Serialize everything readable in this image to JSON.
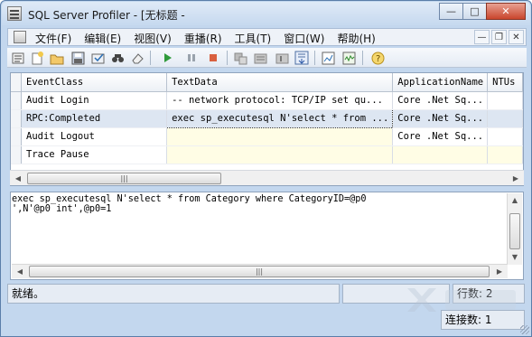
{
  "window": {
    "title": "SQL Server Profiler - [无标题 -"
  },
  "menu": [
    "文件(F)",
    "编辑(E)",
    "视图(V)",
    "重播(R)",
    "工具(T)",
    "窗口(W)",
    "帮助(H)"
  ],
  "grid": {
    "columns": [
      "EventClass",
      "TextData",
      "ApplicationName",
      "NTUs"
    ],
    "rows": [
      {
        "event": "Audit Login",
        "text": "-- network protocol: TCP/IP  set qu...",
        "app": "Core .Net Sq..."
      },
      {
        "event": "RPC:Completed",
        "text": "exec sp_executesql N'select * from ...",
        "app": "Core .Net Sq..."
      },
      {
        "event": "Audit Logout",
        "text": "",
        "app": "Core .Net Sq..."
      },
      {
        "event": "Trace Pause",
        "text": "",
        "app": ""
      }
    ]
  },
  "detail": {
    "line1": "exec sp_executesql N'select * from Category where CategoryID=@p0",
    "line2": "',N'@p0 int',@p0=1"
  },
  "status": {
    "ready": "就绪。",
    "rows": "行数: 2",
    "connections": "连接数: 1"
  },
  "icons": {
    "toolbar": [
      "new-trace-icon",
      "new-template-icon",
      "open-icon",
      "save-icon",
      "properties-icon",
      "find-icon",
      "clear-icon",
      "run-icon",
      "pause-icon",
      "stop-icon",
      "replay-icons",
      "auto-scroll-icon",
      "help-icon"
    ]
  },
  "colors": {
    "titlebar": "#c6d9ef",
    "selected_row": "#dde6f2",
    "close_button": "#c9452c"
  }
}
